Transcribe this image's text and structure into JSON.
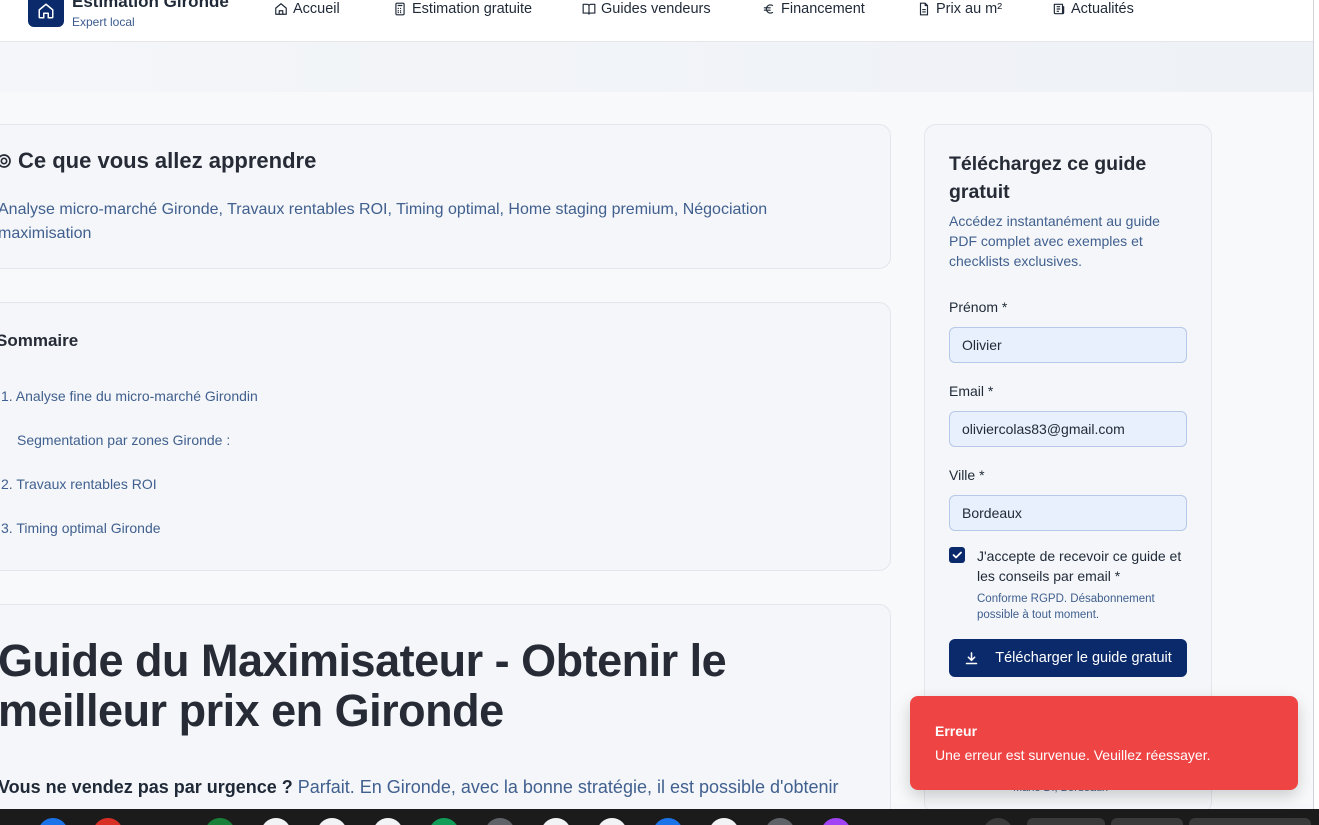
{
  "header": {
    "brand_title": "Estimation Gironde",
    "brand_sub": "Expert local",
    "nav": [
      {
        "label": "Accueil",
        "icon": "home-icon"
      },
      {
        "label": "Estimation gratuite",
        "icon": "calculator-icon"
      },
      {
        "label": "Guides vendeurs",
        "icon": "book-icon"
      },
      {
        "label": "Financement",
        "icon": "euro-icon"
      },
      {
        "label": "Prix au m²",
        "icon": "document-icon"
      },
      {
        "label": "Actualités",
        "icon": "newspaper-icon"
      }
    ]
  },
  "learn": {
    "title": "Ce que vous allez apprendre",
    "text": "Analyse micro-marché Gironde, Travaux rentables ROI, Timing optimal, Home staging premium, Négociation maximisation"
  },
  "toc": {
    "title": "Sommaire",
    "items": [
      "1. Analyse fine du micro-marché Girondin",
      "Segmentation par zones Gironde :",
      "2. Travaux rentables ROI",
      "3. Timing optimal Gironde"
    ]
  },
  "article": {
    "title": "Guide du Maximisateur - Obtenir le meilleur prix en Gironde",
    "intro_bold": "Vous ne vendez pas par urgence ?",
    "intro_rest": " Parfait. En Gironde, avec la bonne stratégie, il est possible d'obtenir"
  },
  "form": {
    "title": "Téléchargez ce guide gratuit",
    "subtitle": "Accédez instantanément au guide PDF complet avec exemples et checklists exclusives.",
    "firstname_label": "Prénom *",
    "firstname_value": "Olivier",
    "email_label": "Email *",
    "email_value": "oliviercolas83@gmail.com",
    "city_label": "Ville *",
    "city_value": "Bordeaux",
    "consent_label": "J'accepte de recevoir ce guide et les conseils par email *",
    "consent_note": "Conforme RGPD. Désabonnement possible à tout moment.",
    "submit_label": "Télécharger le guide gratuit",
    "testimonial_author": "Marie D., Bordeaux"
  },
  "toast": {
    "title": "Erreur",
    "message": "Une erreur est survenue. Veuillez réessayer."
  },
  "colors": {
    "primary": "#0b2a6b",
    "link_text": "#41608f",
    "error": "#ef4444"
  }
}
